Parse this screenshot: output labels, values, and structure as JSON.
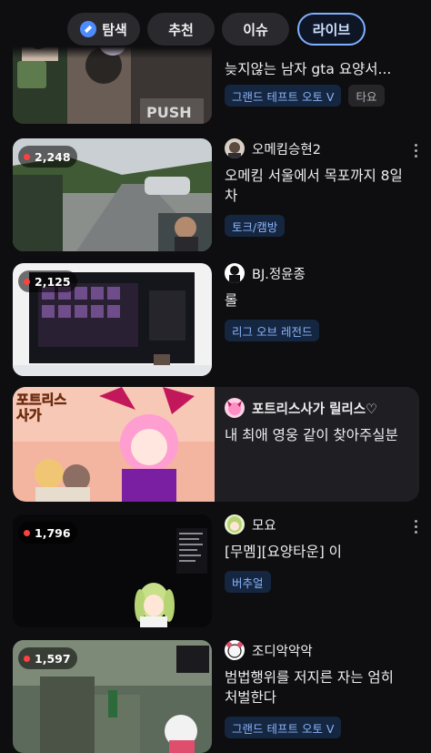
{
  "tabs": [
    {
      "label": "탐색",
      "icon": "compass-icon"
    },
    {
      "label": "추천"
    },
    {
      "label": "이슈"
    },
    {
      "label": "라이브",
      "selected": true
    }
  ],
  "streams": [
    {
      "viewers": "",
      "channel": "",
      "title": "늦지않는 남자 gta 요양서...",
      "tags": [
        "그랜드 테프트 오토 V",
        "타요"
      ]
    },
    {
      "viewers": "2,248",
      "channel": "오메킴승현2",
      "title": "오메킴 서울에서 목포까지 8일차",
      "tags": [
        "토크/캠방"
      ]
    },
    {
      "viewers": "2,125",
      "channel": "BJ.정윤종",
      "title": "롤",
      "tags": [
        "리그 오브 레전드"
      ]
    },
    {
      "viewers": "1,796",
      "channel": "모요",
      "title": "[무멤][요양타운] 이",
      "tags": [
        "버추얼"
      ]
    },
    {
      "viewers": "1,597",
      "channel": "조디악악악",
      "title": "범법행위를 저지른 자는 엄히 처벌한다",
      "tags": [
        "그랜드 테프트 오토 V"
      ]
    }
  ],
  "promo": {
    "channel": "포트리스사가 릴리스♡",
    "title": "내 최애 영웅 같이 찾아주실분",
    "logo_text": "포트리스 사가"
  },
  "colors": {
    "background": "#0e0e10",
    "accent": "#7fb0ff",
    "tag_bg": "#152641",
    "tag_text": "#8ab4f8",
    "live_dot": "#ff4040"
  }
}
